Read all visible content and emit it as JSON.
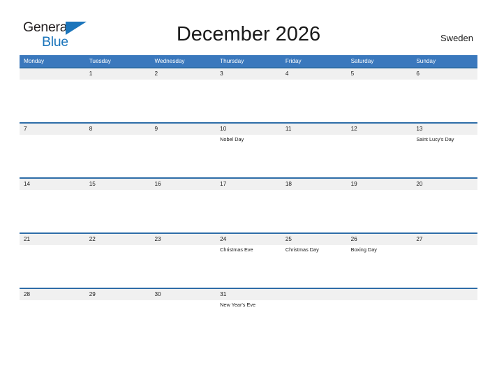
{
  "brand": {
    "name_top": "General",
    "name_bottom": "Blue",
    "flag_icon": "blue-triangle-flag-icon",
    "color_top": "#231f20",
    "color_bottom": "#1b75bb"
  },
  "header": {
    "title": "December 2026",
    "country": "Sweden"
  },
  "theme": {
    "header_blue": "#3a78bd",
    "row_border_blue": "#2e6da8",
    "daynum_band_gray": "#f0f0f0",
    "text_color": "#1a1a1a",
    "page_background": "#ffffff"
  },
  "calendar": {
    "month": "December",
    "year": "2026",
    "week_start": "Monday",
    "weekdays": [
      "Monday",
      "Tuesday",
      "Wednesday",
      "Thursday",
      "Friday",
      "Saturday",
      "Sunday"
    ],
    "weeks": [
      [
        {
          "day": "",
          "event": ""
        },
        {
          "day": "1",
          "event": ""
        },
        {
          "day": "2",
          "event": ""
        },
        {
          "day": "3",
          "event": ""
        },
        {
          "day": "4",
          "event": ""
        },
        {
          "day": "5",
          "event": ""
        },
        {
          "day": "6",
          "event": ""
        }
      ],
      [
        {
          "day": "7",
          "event": ""
        },
        {
          "day": "8",
          "event": ""
        },
        {
          "day": "9",
          "event": ""
        },
        {
          "day": "10",
          "event": "Nobel Day"
        },
        {
          "day": "11",
          "event": ""
        },
        {
          "day": "12",
          "event": ""
        },
        {
          "day": "13",
          "event": "Saint Lucy's Day"
        }
      ],
      [
        {
          "day": "14",
          "event": ""
        },
        {
          "day": "15",
          "event": ""
        },
        {
          "day": "16",
          "event": ""
        },
        {
          "day": "17",
          "event": ""
        },
        {
          "day": "18",
          "event": ""
        },
        {
          "day": "19",
          "event": ""
        },
        {
          "day": "20",
          "event": ""
        }
      ],
      [
        {
          "day": "21",
          "event": ""
        },
        {
          "day": "22",
          "event": ""
        },
        {
          "day": "23",
          "event": ""
        },
        {
          "day": "24",
          "event": "Christmas Eve"
        },
        {
          "day": "25",
          "event": "Christmas Day"
        },
        {
          "day": "26",
          "event": "Boxing Day"
        },
        {
          "day": "27",
          "event": ""
        }
      ],
      [
        {
          "day": "28",
          "event": ""
        },
        {
          "day": "29",
          "event": ""
        },
        {
          "day": "30",
          "event": ""
        },
        {
          "day": "31",
          "event": "New Year's Eve"
        },
        {
          "day": "",
          "event": ""
        },
        {
          "day": "",
          "event": ""
        },
        {
          "day": "",
          "event": ""
        }
      ]
    ]
  }
}
